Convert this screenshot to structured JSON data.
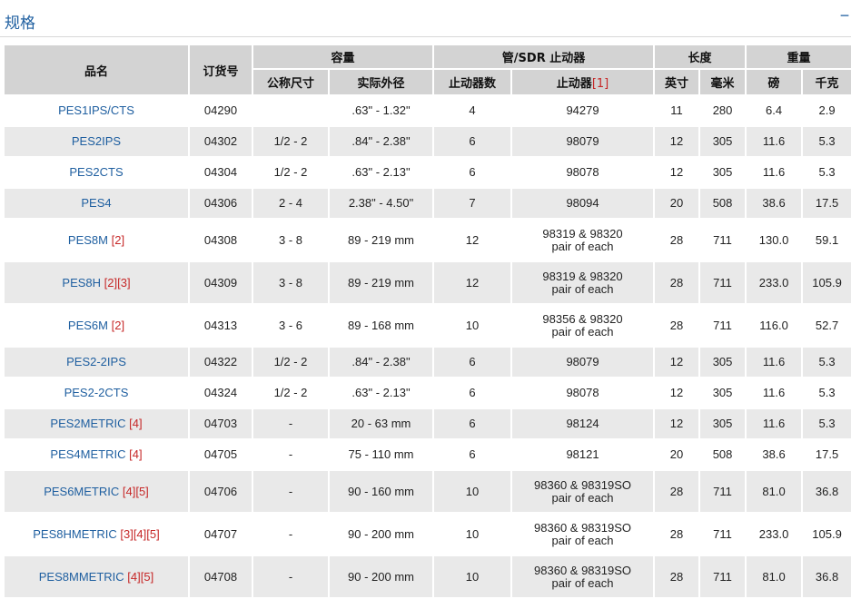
{
  "section": {
    "title": "规格",
    "collapse_symbol": "−"
  },
  "headers": {
    "name": "品名",
    "order_no": "订货号",
    "capacity": "容量",
    "nominal_size": "公称尺寸",
    "actual_od": "实际外径",
    "pipe_sdr_stopper": "管/SDR 止动器",
    "stopper_count": "止动器数",
    "stopper": "止动器",
    "stopper_ref": "[1]",
    "length": "长度",
    "inch": "英寸",
    "mm": "毫米",
    "weight": "重量",
    "lb": "磅",
    "kg": "千克"
  },
  "rows": [
    {
      "name": "PES1IPS/CTS",
      "refs": "",
      "order_no": "04290",
      "nominal": "",
      "actual": ".63\" - 1.32\"",
      "count": "4",
      "stopper": "94279",
      "stopper_sub": "",
      "inch": "11",
      "mm": "280",
      "lb": "6.4",
      "kg": "2.9"
    },
    {
      "name": "PES2IPS",
      "refs": "",
      "order_no": "04302",
      "nominal": "1/2 - 2",
      "actual": ".84\" - 2.38\"",
      "count": "6",
      "stopper": "98079",
      "stopper_sub": "",
      "inch": "12",
      "mm": "305",
      "lb": "11.6",
      "kg": "5.3"
    },
    {
      "name": "PES2CTS",
      "refs": "",
      "order_no": "04304",
      "nominal": "1/2 - 2",
      "actual": ".63\" - 2.13\"",
      "count": "6",
      "stopper": "98078",
      "stopper_sub": "",
      "inch": "12",
      "mm": "305",
      "lb": "11.6",
      "kg": "5.3"
    },
    {
      "name": "PES4",
      "refs": "",
      "order_no": "04306",
      "nominal": "2 - 4",
      "actual": "2.38\" - 4.50\"",
      "count": "7",
      "stopper": "98094",
      "stopper_sub": "",
      "inch": "20",
      "mm": "508",
      "lb": "38.6",
      "kg": "17.5"
    },
    {
      "name": "PES8M",
      "refs": "[2]",
      "order_no": "04308",
      "nominal": "3 - 8",
      "actual": "89 - 219 mm",
      "count": "12",
      "stopper": "98319 & 98320",
      "stopper_sub": "pair of each",
      "inch": "28",
      "mm": "711",
      "lb": "130.0",
      "kg": "59.1"
    },
    {
      "name": "PES8H",
      "refs": "[2][3]",
      "order_no": "04309",
      "nominal": "3 - 8",
      "actual": "89 - 219 mm",
      "count": "12",
      "stopper": "98319 & 98320",
      "stopper_sub": "pair of each",
      "inch": "28",
      "mm": "711",
      "lb": "233.0",
      "kg": "105.9"
    },
    {
      "name": "PES6M",
      "refs": "[2]",
      "order_no": "04313",
      "nominal": "3 - 6",
      "actual": "89 - 168 mm",
      "count": "10",
      "stopper": "98356 & 98320",
      "stopper_sub": "pair of each",
      "inch": "28",
      "mm": "711",
      "lb": "116.0",
      "kg": "52.7"
    },
    {
      "name": "PES2-2IPS",
      "refs": "",
      "order_no": "04322",
      "nominal": "1/2 - 2",
      "actual": ".84\" - 2.38\"",
      "count": "6",
      "stopper": "98079",
      "stopper_sub": "",
      "inch": "12",
      "mm": "305",
      "lb": "11.6",
      "kg": "5.3"
    },
    {
      "name": "PES2-2CTS",
      "refs": "",
      "order_no": "04324",
      "nominal": "1/2 - 2",
      "actual": ".63\" - 2.13\"",
      "count": "6",
      "stopper": "98078",
      "stopper_sub": "",
      "inch": "12",
      "mm": "305",
      "lb": "11.6",
      "kg": "5.3"
    },
    {
      "name": "PES2METRIC",
      "refs": "[4]",
      "order_no": "04703",
      "nominal": "-",
      "actual": "20 - 63 mm",
      "count": "6",
      "stopper": "98124",
      "stopper_sub": "",
      "inch": "12",
      "mm": "305",
      "lb": "11.6",
      "kg": "5.3"
    },
    {
      "name": "PES4METRIC",
      "refs": "[4]",
      "order_no": "04705",
      "nominal": "-",
      "actual": "75 - 110 mm",
      "count": "6",
      "stopper": "98121",
      "stopper_sub": "",
      "inch": "20",
      "mm": "508",
      "lb": "38.6",
      "kg": "17.5"
    },
    {
      "name": "PES6METRIC",
      "refs": "[4][5]",
      "order_no": "04706",
      "nominal": "-",
      "actual": "90 - 160 mm",
      "count": "10",
      "stopper": "98360 & 98319SO",
      "stopper_sub": "pair of each",
      "inch": "28",
      "mm": "711",
      "lb": "81.0",
      "kg": "36.8"
    },
    {
      "name": "PES8HMETRIC",
      "refs": "[3][4][5]",
      "order_no": "04707",
      "nominal": "-",
      "actual": "90 - 200 mm",
      "count": "10",
      "stopper": "98360 & 98319SO",
      "stopper_sub": "pair of each",
      "inch": "28",
      "mm": "711",
      "lb": "233.0",
      "kg": "105.9"
    },
    {
      "name": "PES8MMETRIC",
      "refs": "[4][5]",
      "order_no": "04708",
      "nominal": "-",
      "actual": "90 - 200 mm",
      "count": "10",
      "stopper": "98360 & 98319SO",
      "stopper_sub": "pair of each",
      "inch": "28",
      "mm": "711",
      "lb": "81.0",
      "kg": "36.8"
    }
  ]
}
